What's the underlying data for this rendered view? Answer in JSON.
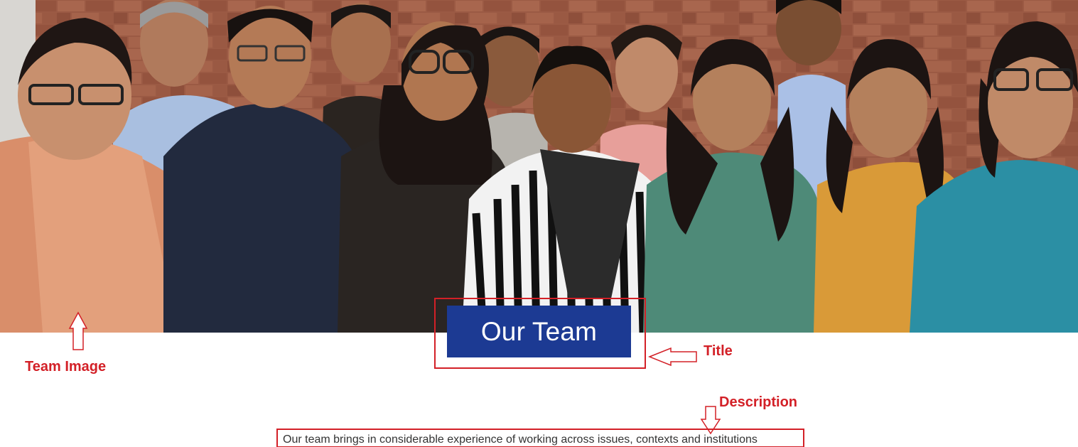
{
  "hero": {
    "image_icon": "team-photo-image",
    "title": "Our Team",
    "description": "Our team brings in considerable experience of working across issues, contexts and institutions"
  },
  "annotations": {
    "team_image_label": "Team Image",
    "title_label": "Title",
    "description_label": "Description",
    "color": "#d32027"
  },
  "colors": {
    "title_bg": "#1c3a93",
    "title_text": "#ffffff",
    "description_text": "#333333"
  }
}
